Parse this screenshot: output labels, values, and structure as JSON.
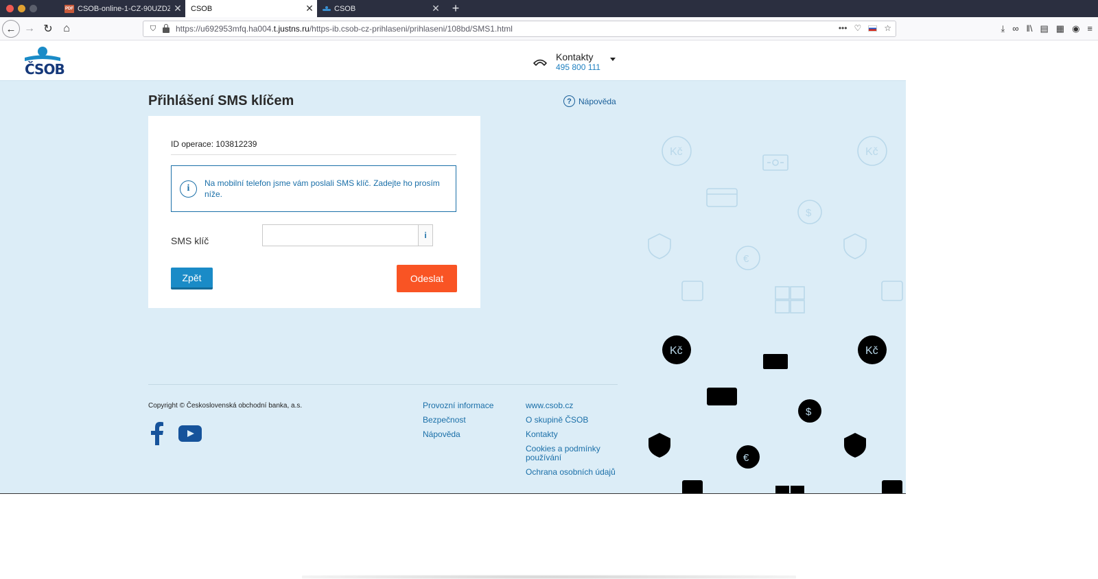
{
  "browser": {
    "tabs": [
      {
        "label": "CSOB-online-1-CZ-90UZDZ.pdf",
        "badge": "PDF"
      },
      {
        "label": "CSOB"
      },
      {
        "label": "CSOB"
      }
    ],
    "url_prefix": "https://u692953mfq.ha004.",
    "url_domain": "t.justns.ru",
    "url_path": "/https-ib.csob-cz-prihlaseni/prihlaseni/108bd/SMS1.html"
  },
  "header": {
    "logo_text": "ČSOB",
    "contacts_title": "Kontakty",
    "contacts_phone": "495 800 111"
  },
  "main": {
    "title": "Přihlášení SMS klíčem",
    "help_label": "Nápověda",
    "operation_id": "ID operace: 103812239",
    "info_message": "Na mobilní telefon jsme vám poslali SMS klíč. Zadejte ho prosím níže.",
    "sms_label": "SMS klíč",
    "sms_value": "",
    "sms_info": "i",
    "back_button": "Zpět",
    "send_button": "Odeslat"
  },
  "footer": {
    "copyright": "Copyright © Československá obchodní banka, a.s.",
    "col1": [
      "Provozní informace",
      "Bezpečnost",
      "Nápověda"
    ],
    "col2": [
      "www.csob.cz",
      "O skupině ČSOB",
      "Kontakty",
      "Cookies a podmínky používání",
      "Ochrana osobních údajů"
    ]
  },
  "colors": {
    "page_bg": "#dcedf7",
    "brand_blue": "#16397a",
    "link_blue": "#1a6fa8",
    "back_button": "#1a8bc7",
    "send_button": "#f95424"
  }
}
